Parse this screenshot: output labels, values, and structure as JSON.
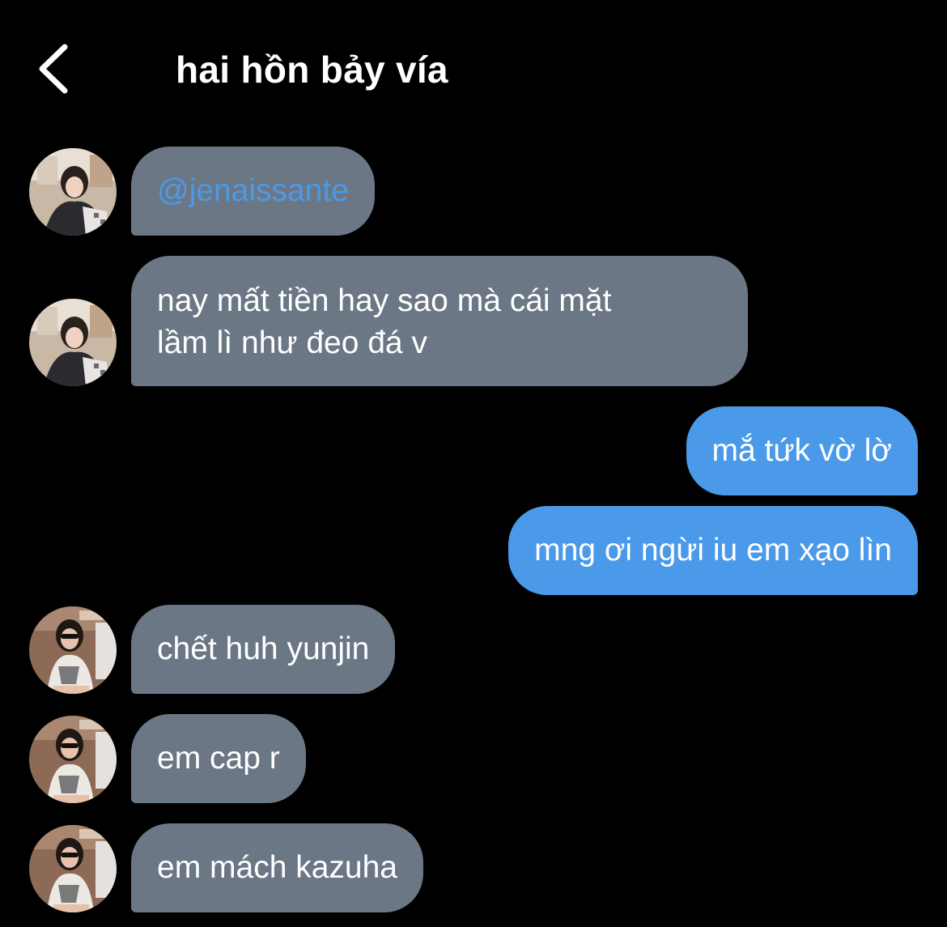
{
  "header": {
    "title": "hai hồn bảy vía",
    "back_icon": "chevron-left-icon"
  },
  "messages": [
    {
      "direction": "incoming",
      "sender_avatar": "avatar-jennie",
      "text": "@jenaissante",
      "is_mention": true
    },
    {
      "direction": "incoming",
      "sender_avatar": "avatar-jennie",
      "lines": [
        "nay mất tiền hay sao mà cái mặt",
        "lầm lì như đeo đá v"
      ]
    },
    {
      "direction": "outgoing",
      "text": "mắ tứk vờ lờ"
    },
    {
      "direction": "outgoing",
      "text": "mng ơi ngừi iu em xạo lìn"
    },
    {
      "direction": "incoming",
      "sender_avatar": "avatar-yunjin",
      "text": "chết huh yunjin"
    },
    {
      "direction": "incoming",
      "sender_avatar": "avatar-yunjin",
      "text": "em cap r"
    },
    {
      "direction": "incoming",
      "sender_avatar": "avatar-yunjin",
      "text": "em mách kazuha"
    }
  ],
  "colors": {
    "background": "#000000",
    "incoming_bubble": "#6b7785",
    "outgoing_bubble": "#4a9ae9",
    "mention": "#4a9ae9",
    "text": "#ffffff"
  }
}
